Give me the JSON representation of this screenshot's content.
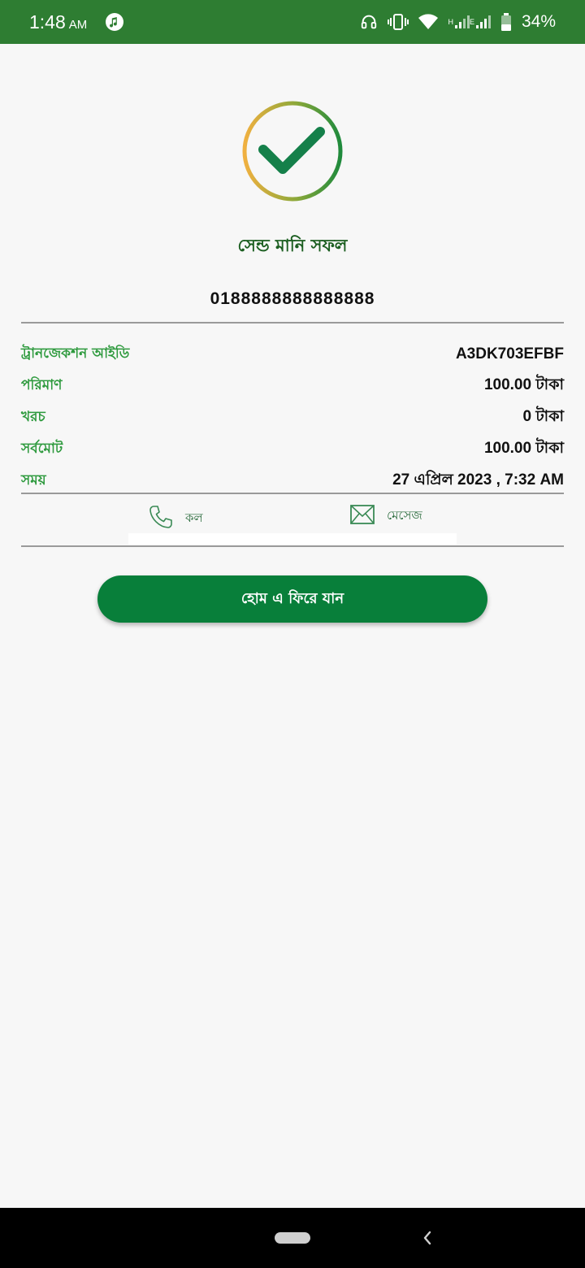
{
  "status_bar": {
    "time": "1:48",
    "ampm": "AM",
    "battery": "34%",
    "network": "H",
    "network2": "E",
    "icons": [
      "music-icon",
      "headphones-icon",
      "vibrate-icon",
      "wifi-icon",
      "signal-icon",
      "battery-icon"
    ]
  },
  "result": {
    "title": "সেন্ড মানি সফল",
    "phone": "0188888888888888"
  },
  "details": [
    {
      "label": "ট্রানজেকশন আইডি",
      "value": "A3DK703EFBF"
    },
    {
      "label": "পরিমাণ",
      "value": "100.00 টাকা"
    },
    {
      "label": "খরচ",
      "value": "0 টাকা"
    },
    {
      "label": "সর্বমোট",
      "value": "100.00 টাকা"
    },
    {
      "label": "সময়",
      "value": "27 এপ্রিল 2023 , 7:32 AM"
    }
  ],
  "actions": {
    "call_label": "কল",
    "message_label": "মেসেজ"
  },
  "home_button": {
    "label": "হোম এ ফিরে যান"
  },
  "colors": {
    "status_bar": "#2e7d32",
    "accent": "#087f3a",
    "label_green": "#2e9a3e"
  }
}
